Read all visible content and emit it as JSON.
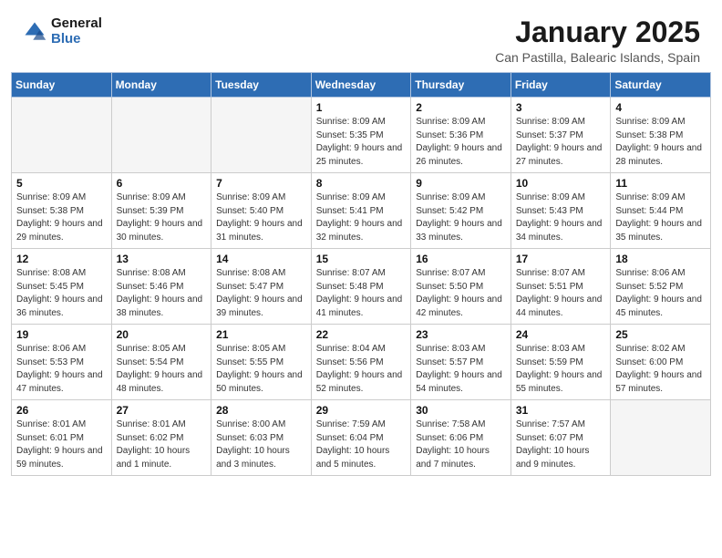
{
  "header": {
    "logo_general": "General",
    "logo_blue": "Blue",
    "month_title": "January 2025",
    "location": "Can Pastilla, Balearic Islands, Spain"
  },
  "weekdays": [
    "Sunday",
    "Monday",
    "Tuesday",
    "Wednesday",
    "Thursday",
    "Friday",
    "Saturday"
  ],
  "weeks": [
    [
      {
        "day": "",
        "info": ""
      },
      {
        "day": "",
        "info": ""
      },
      {
        "day": "",
        "info": ""
      },
      {
        "day": "1",
        "info": "Sunrise: 8:09 AM\nSunset: 5:35 PM\nDaylight: 9 hours and 25 minutes."
      },
      {
        "day": "2",
        "info": "Sunrise: 8:09 AM\nSunset: 5:36 PM\nDaylight: 9 hours and 26 minutes."
      },
      {
        "day": "3",
        "info": "Sunrise: 8:09 AM\nSunset: 5:37 PM\nDaylight: 9 hours and 27 minutes."
      },
      {
        "day": "4",
        "info": "Sunrise: 8:09 AM\nSunset: 5:38 PM\nDaylight: 9 hours and 28 minutes."
      }
    ],
    [
      {
        "day": "5",
        "info": "Sunrise: 8:09 AM\nSunset: 5:38 PM\nDaylight: 9 hours and 29 minutes."
      },
      {
        "day": "6",
        "info": "Sunrise: 8:09 AM\nSunset: 5:39 PM\nDaylight: 9 hours and 30 minutes."
      },
      {
        "day": "7",
        "info": "Sunrise: 8:09 AM\nSunset: 5:40 PM\nDaylight: 9 hours and 31 minutes."
      },
      {
        "day": "8",
        "info": "Sunrise: 8:09 AM\nSunset: 5:41 PM\nDaylight: 9 hours and 32 minutes."
      },
      {
        "day": "9",
        "info": "Sunrise: 8:09 AM\nSunset: 5:42 PM\nDaylight: 9 hours and 33 minutes."
      },
      {
        "day": "10",
        "info": "Sunrise: 8:09 AM\nSunset: 5:43 PM\nDaylight: 9 hours and 34 minutes."
      },
      {
        "day": "11",
        "info": "Sunrise: 8:09 AM\nSunset: 5:44 PM\nDaylight: 9 hours and 35 minutes."
      }
    ],
    [
      {
        "day": "12",
        "info": "Sunrise: 8:08 AM\nSunset: 5:45 PM\nDaylight: 9 hours and 36 minutes."
      },
      {
        "day": "13",
        "info": "Sunrise: 8:08 AM\nSunset: 5:46 PM\nDaylight: 9 hours and 38 minutes."
      },
      {
        "day": "14",
        "info": "Sunrise: 8:08 AM\nSunset: 5:47 PM\nDaylight: 9 hours and 39 minutes."
      },
      {
        "day": "15",
        "info": "Sunrise: 8:07 AM\nSunset: 5:48 PM\nDaylight: 9 hours and 41 minutes."
      },
      {
        "day": "16",
        "info": "Sunrise: 8:07 AM\nSunset: 5:50 PM\nDaylight: 9 hours and 42 minutes."
      },
      {
        "day": "17",
        "info": "Sunrise: 8:07 AM\nSunset: 5:51 PM\nDaylight: 9 hours and 44 minutes."
      },
      {
        "day": "18",
        "info": "Sunrise: 8:06 AM\nSunset: 5:52 PM\nDaylight: 9 hours and 45 minutes."
      }
    ],
    [
      {
        "day": "19",
        "info": "Sunrise: 8:06 AM\nSunset: 5:53 PM\nDaylight: 9 hours and 47 minutes."
      },
      {
        "day": "20",
        "info": "Sunrise: 8:05 AM\nSunset: 5:54 PM\nDaylight: 9 hours and 48 minutes."
      },
      {
        "day": "21",
        "info": "Sunrise: 8:05 AM\nSunset: 5:55 PM\nDaylight: 9 hours and 50 minutes."
      },
      {
        "day": "22",
        "info": "Sunrise: 8:04 AM\nSunset: 5:56 PM\nDaylight: 9 hours and 52 minutes."
      },
      {
        "day": "23",
        "info": "Sunrise: 8:03 AM\nSunset: 5:57 PM\nDaylight: 9 hours and 54 minutes."
      },
      {
        "day": "24",
        "info": "Sunrise: 8:03 AM\nSunset: 5:59 PM\nDaylight: 9 hours and 55 minutes."
      },
      {
        "day": "25",
        "info": "Sunrise: 8:02 AM\nSunset: 6:00 PM\nDaylight: 9 hours and 57 minutes."
      }
    ],
    [
      {
        "day": "26",
        "info": "Sunrise: 8:01 AM\nSunset: 6:01 PM\nDaylight: 9 hours and 59 minutes."
      },
      {
        "day": "27",
        "info": "Sunrise: 8:01 AM\nSunset: 6:02 PM\nDaylight: 10 hours and 1 minute."
      },
      {
        "day": "28",
        "info": "Sunrise: 8:00 AM\nSunset: 6:03 PM\nDaylight: 10 hours and 3 minutes."
      },
      {
        "day": "29",
        "info": "Sunrise: 7:59 AM\nSunset: 6:04 PM\nDaylight: 10 hours and 5 minutes."
      },
      {
        "day": "30",
        "info": "Sunrise: 7:58 AM\nSunset: 6:06 PM\nDaylight: 10 hours and 7 minutes."
      },
      {
        "day": "31",
        "info": "Sunrise: 7:57 AM\nSunset: 6:07 PM\nDaylight: 10 hours and 9 minutes."
      },
      {
        "day": "",
        "info": ""
      }
    ]
  ]
}
